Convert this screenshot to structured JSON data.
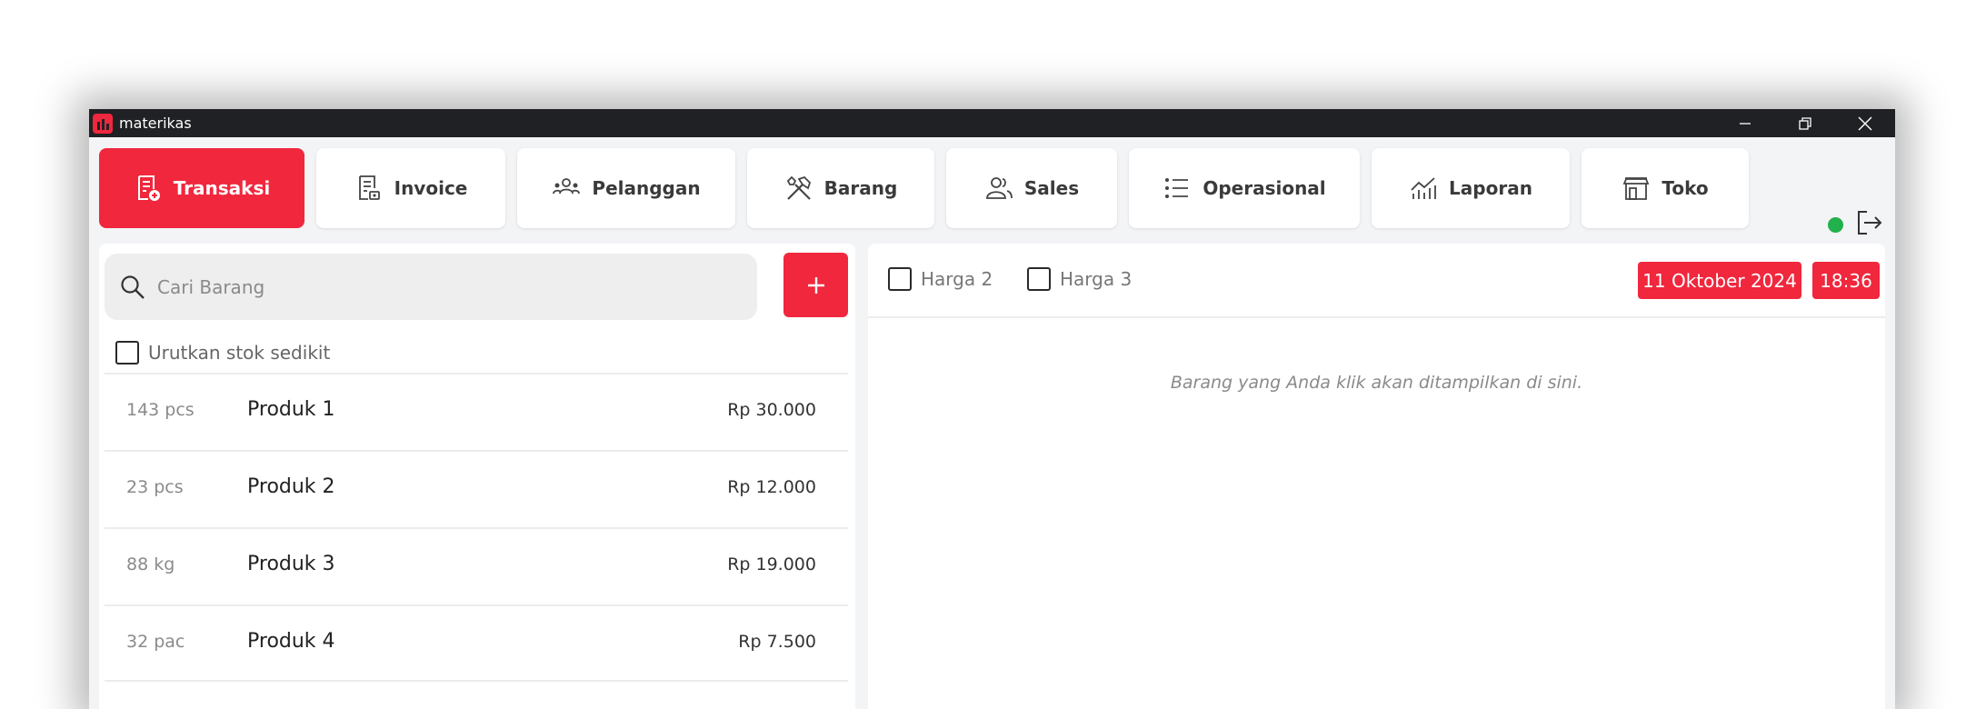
{
  "window": {
    "title": "materikas",
    "controls": [
      "minimize-icon",
      "restore-icon",
      "close-icon"
    ]
  },
  "nav": {
    "items": [
      {
        "label": "Transaksi",
        "icon": "receipt-icon",
        "active": true
      },
      {
        "label": "Invoice",
        "icon": "invoice-icon",
        "active": false
      },
      {
        "label": "Pelanggan",
        "icon": "customers-icon",
        "active": false
      },
      {
        "label": "Barang",
        "icon": "tools-icon",
        "active": false
      },
      {
        "label": "Sales",
        "icon": "sales-icon",
        "active": false
      },
      {
        "label": "Operasional",
        "icon": "list-icon",
        "active": false
      },
      {
        "label": "Laporan",
        "icon": "chart-icon",
        "active": false
      },
      {
        "label": "Toko",
        "icon": "store-icon",
        "active": false
      }
    ],
    "status": "online",
    "logout_icon": "logout-icon"
  },
  "search": {
    "placeholder": "Cari Barang",
    "value": ""
  },
  "sort": {
    "label": "Urutkan stok sedikit",
    "checked": false
  },
  "products": [
    {
      "stock": "143 pcs",
      "name": "Produk 1",
      "price": "Rp 30.000"
    },
    {
      "stock": "23 pcs",
      "name": "Produk 2",
      "price": "Rp 12.000"
    },
    {
      "stock": "88 kg",
      "name": "Produk 3",
      "price": "Rp 19.000"
    },
    {
      "stock": "32 pac",
      "name": "Produk 4",
      "price": "Rp 7.500"
    }
  ],
  "cart": {
    "price_options": [
      {
        "label": "Harga 2",
        "checked": false
      },
      {
        "label": "Harga 3",
        "checked": false
      }
    ],
    "date": "11 Oktober 2024",
    "time": "18:36",
    "empty_message": "Barang yang Anda klik akan ditampilkan di sini."
  },
  "colors": {
    "accent": "#f0273d",
    "titlebar": "#202124",
    "status_online": "#22b14c",
    "background": "#f3f4f6"
  }
}
